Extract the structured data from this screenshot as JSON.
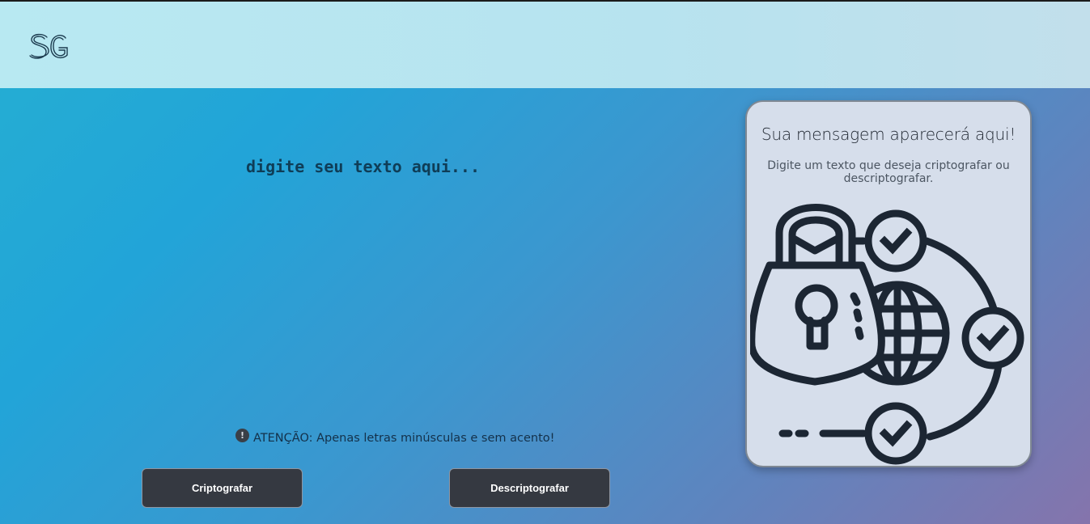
{
  "header": {
    "logo_text": "SG"
  },
  "input": {
    "placeholder": "digite seu texto aqui..."
  },
  "notice": {
    "icon": "exclamation-circle-icon",
    "icon_glyph": "!",
    "text": "ATENÇÃO: Apenas letras minúsculas e sem acento!"
  },
  "buttons": {
    "encrypt_label": "Criptografar",
    "decrypt_label": "Descriptografar"
  },
  "result": {
    "title": "Sua mensagem aparecerá aqui!",
    "subtitle": "Digite um texto que deseja criptografar ou descriptografar.",
    "illustration": "padlock-globe-checkmarks-illustration"
  },
  "colors": {
    "button_bg": "#353941",
    "card_bg": "#d6deeb",
    "header_bg": "#b8e9f2",
    "text_dark": "#0f3d57"
  }
}
